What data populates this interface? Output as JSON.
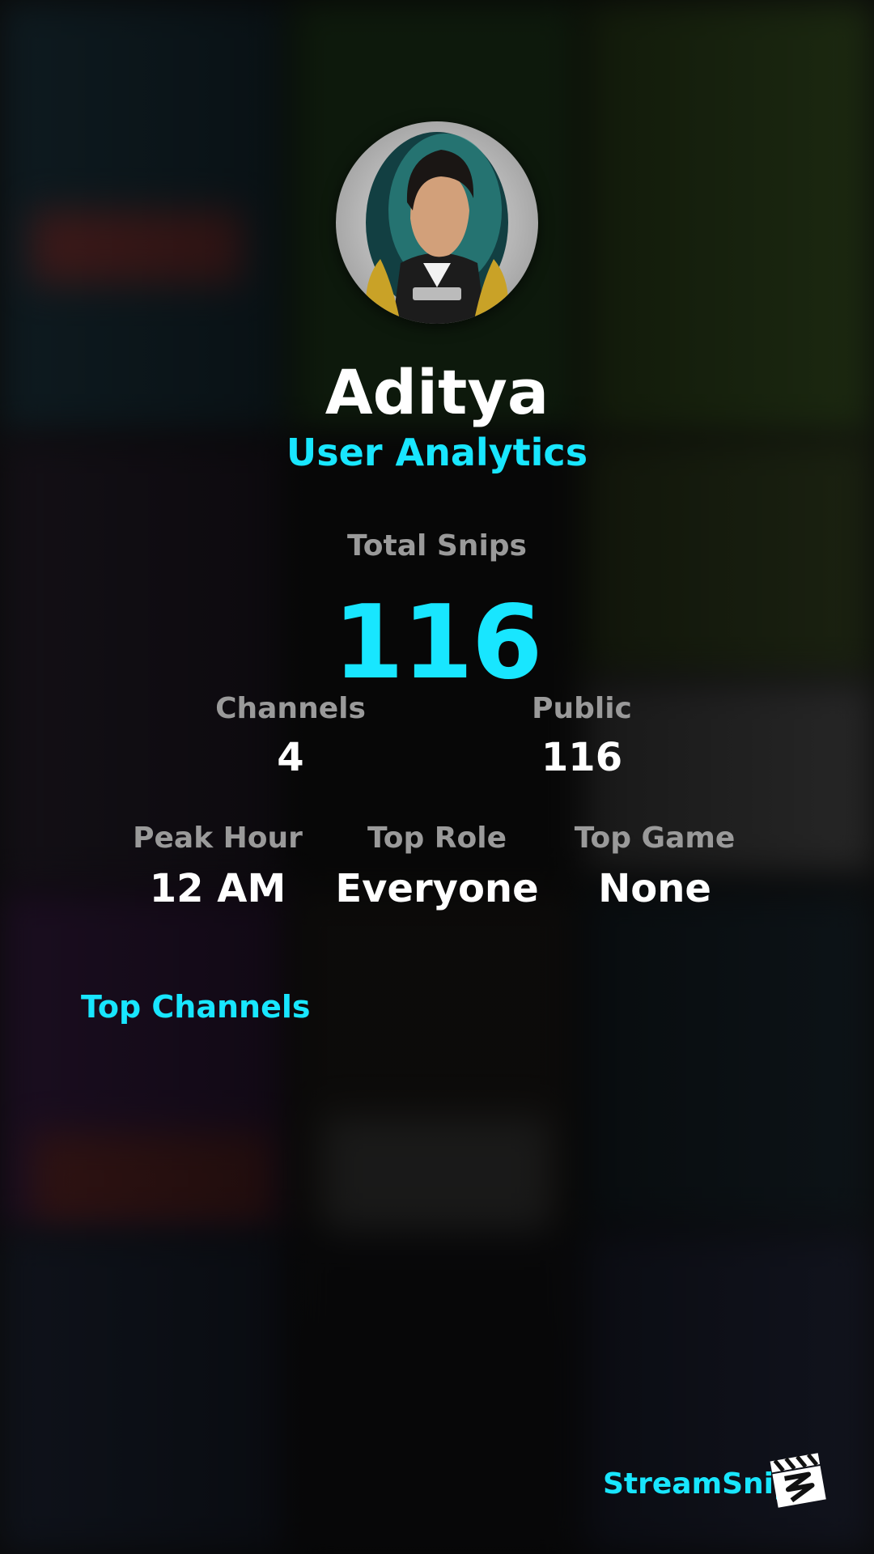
{
  "profile": {
    "username": "Aditya",
    "subtitle": "User Analytics"
  },
  "stats": {
    "total_snips_label": "Total Snips",
    "total_snips_value": "116",
    "channels_label": "Channels",
    "channels_value": "4",
    "public_label": "Public",
    "public_value": "116",
    "peak_hour_label": "Peak Hour",
    "peak_hour_value": "12 AM",
    "top_role_label": "Top Role",
    "top_role_value": "Everyone",
    "top_game_label": "Top Game",
    "top_game_value": "None"
  },
  "sections": {
    "top_channels_title": "Top Channels"
  },
  "branding": {
    "name": "StreamSnip",
    "logo_icon": "clapperboard-icon"
  },
  "colors": {
    "accent": "#18e6ff",
    "label_gray": "#9a9a9a",
    "value_white": "#ffffff"
  }
}
